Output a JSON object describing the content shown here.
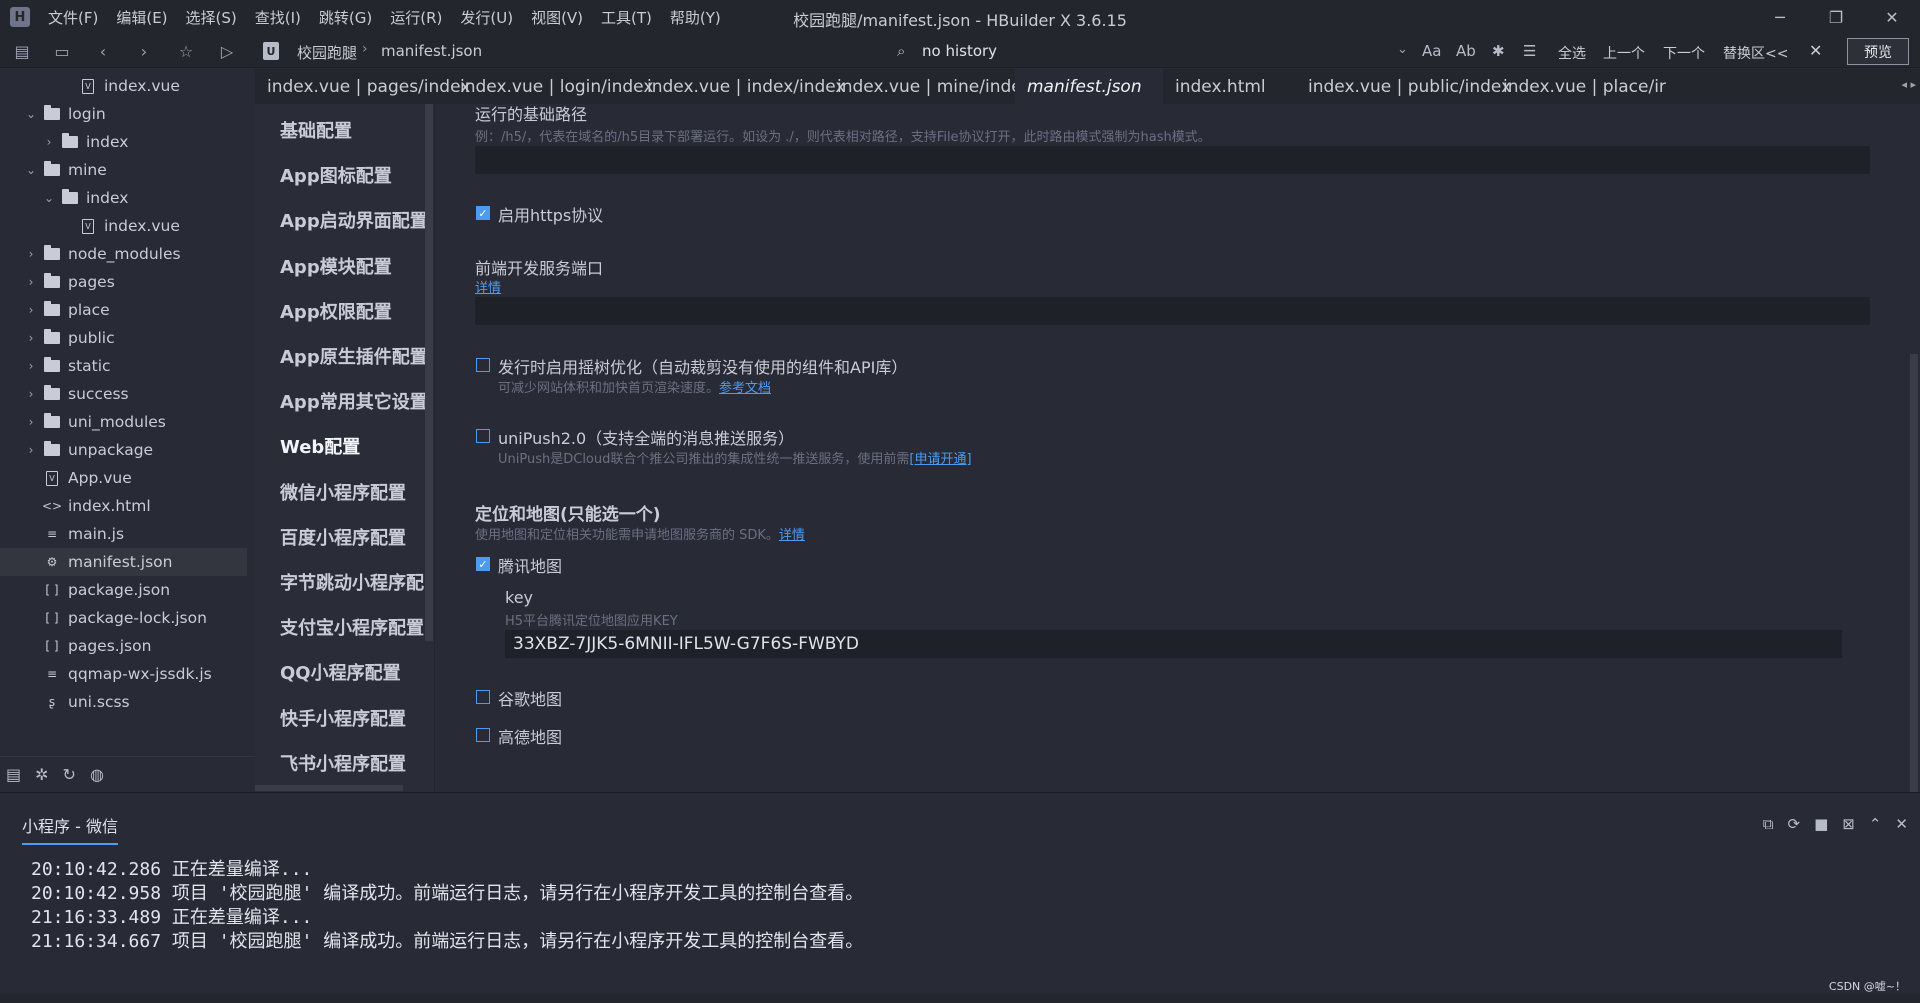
{
  "window": {
    "title": "校园跑腿/manifest.json - HBuilder X 3.6.15",
    "logo": "H",
    "controls": [
      "─",
      "❐",
      "✕"
    ]
  },
  "menu": [
    "文件(F)",
    "编辑(E)",
    "选择(S)",
    "查找(I)",
    "跳转(G)",
    "运行(R)",
    "发行(U)",
    "视图(V)",
    "工具(T)",
    "帮助(Y)"
  ],
  "toolbar": {
    "breadcrumb_root": "校园跑腿",
    "breadcrumb_file": "manifest.json",
    "search_placeholder": "no history",
    "case_label": "Aa",
    "word_label": "Ab",
    "select_all": "全选",
    "prev": "上一个",
    "next": "下一个",
    "replace": "替换区<<",
    "preview": "预览"
  },
  "filetree": [
    {
      "label": "index.vue",
      "type": "vue",
      "indent": 2
    },
    {
      "label": "login",
      "type": "folder-open",
      "indent": 0,
      "chevron": "⌄"
    },
    {
      "label": "index",
      "type": "folder",
      "indent": 1,
      "chevron": "›"
    },
    {
      "label": "mine",
      "type": "folder-open",
      "indent": 0,
      "chevron": "⌄"
    },
    {
      "label": "index",
      "type": "folder-open",
      "indent": 1,
      "chevron": "⌄"
    },
    {
      "label": "index.vue",
      "type": "vue",
      "indent": 2
    },
    {
      "label": "node_modules",
      "type": "folder",
      "indent": 0,
      "chevron": "›"
    },
    {
      "label": "pages",
      "type": "folder",
      "indent": 0,
      "chevron": "›"
    },
    {
      "label": "place",
      "type": "folder",
      "indent": 0,
      "chevron": "›"
    },
    {
      "label": "public",
      "type": "folder",
      "indent": 0,
      "chevron": "›"
    },
    {
      "label": "static",
      "type": "folder",
      "indent": 0,
      "chevron": "›"
    },
    {
      "label": "success",
      "type": "folder",
      "indent": 0,
      "chevron": "›"
    },
    {
      "label": "uni_modules",
      "type": "folder",
      "indent": 0,
      "chevron": "›"
    },
    {
      "label": "unpackage",
      "type": "folder",
      "indent": 0,
      "chevron": "›"
    },
    {
      "label": "App.vue",
      "type": "vue",
      "indent": 0
    },
    {
      "label": "index.html",
      "type": "html",
      "indent": 0
    },
    {
      "label": "main.js",
      "type": "js",
      "indent": 0
    },
    {
      "label": "manifest.json",
      "type": "manifest",
      "indent": 0,
      "selected": true
    },
    {
      "label": "package.json",
      "type": "json",
      "indent": 0
    },
    {
      "label": "package-lock.json",
      "type": "json",
      "indent": 0
    },
    {
      "label": "pages.json",
      "type": "json",
      "indent": 0
    },
    {
      "label": "qqmap-wx-jssdk.js",
      "type": "js",
      "indent": 0
    },
    {
      "label": "uni.scss",
      "type": "scss",
      "indent": 0
    }
  ],
  "tabs": [
    {
      "label": "index.vue | pages/index"
    },
    {
      "label": "index.vue | login/index"
    },
    {
      "label": "index.vue | index/index"
    },
    {
      "label": "index.vue | mine/index"
    },
    {
      "label": "manifest.json",
      "active": true
    },
    {
      "label": "index.html"
    },
    {
      "label": "index.vue | public/index"
    },
    {
      "label": "index.vue | place/ir"
    }
  ],
  "settings_nav": [
    {
      "label": "基础配置"
    },
    {
      "label": "App图标配置"
    },
    {
      "label": "App启动界面配置"
    },
    {
      "label": "App模块配置"
    },
    {
      "label": "App权限配置"
    },
    {
      "label": "App原生插件配置"
    },
    {
      "label": "App常用其它设置"
    },
    {
      "label": "Web配置",
      "active": true
    },
    {
      "label": "微信小程序配置"
    },
    {
      "label": "百度小程序配置"
    },
    {
      "label": "字节跳动小程序配"
    },
    {
      "label": "支付宝小程序配置"
    },
    {
      "label": "QQ小程序配置"
    },
    {
      "label": "快手小程序配置"
    },
    {
      "label": "飞书小程序配置"
    }
  ],
  "web": {
    "base_path_label": "运行的基础路径",
    "base_path_hint": "例：/h5/，代表在域名的/h5目录下部署运行。如设为 ./，则代表相对路径，支持File协议打开，此时路由模式强制为hash模式。",
    "base_path_value": "",
    "https_label": "启用https协议",
    "https_checked": true,
    "port_label": "前端开发服务端口",
    "port_link": "详情",
    "port_value": "",
    "treeshake_label": "发行时启用摇树优化（自动裁剪没有使用的组件和API库）",
    "treeshake_hint": "可减少网站体积和加快首页渲染速度。",
    "treeshake_link": "参考文档",
    "treeshake_checked": false,
    "unipush_label": "uniPush2.0（支持全端的消息推送服务）",
    "unipush_hint": "UniPush是DCloud联合个推公司推出的集成性统一推送服务，使用前需",
    "unipush_link": "[申请开通]",
    "unipush_checked": false,
    "map_title": "定位和地图(只能选一个)",
    "map_hint": "使用地图和定位相关功能需申请地图服务商的 SDK。",
    "map_link": "详情",
    "tencent_label": "腾讯地图",
    "tencent_checked": true,
    "key_label": "key",
    "key_hint": "H5平台腾讯定位地图应用KEY",
    "key_value": "33XBZ-7JJK5-6MNII-IFL5W-G7F6S-FWBYD",
    "google_label": "谷歌地图",
    "google_checked": false,
    "amap_label": "高德地图",
    "amap_checked": false
  },
  "console": {
    "tab": "小程序 - 微信",
    "lines": [
      "20:10:42.286 正在差量编译...",
      "20:10:42.958 项目 '校园跑腿' 编译成功。前端运行日志，请另行在小程序开发工具的控制台查看。",
      "21:16:33.489 正在差量编译...",
      "21:16:34.667 项目 '校园跑腿' 编译成功。前端运行日志，请另行在小程序开发工具的控制台查看。"
    ]
  },
  "watermark": "CSDN @嘘~！",
  "colors": {
    "accent": "#4d9bf0",
    "background": "#282a36",
    "chrome": "#24262e"
  }
}
